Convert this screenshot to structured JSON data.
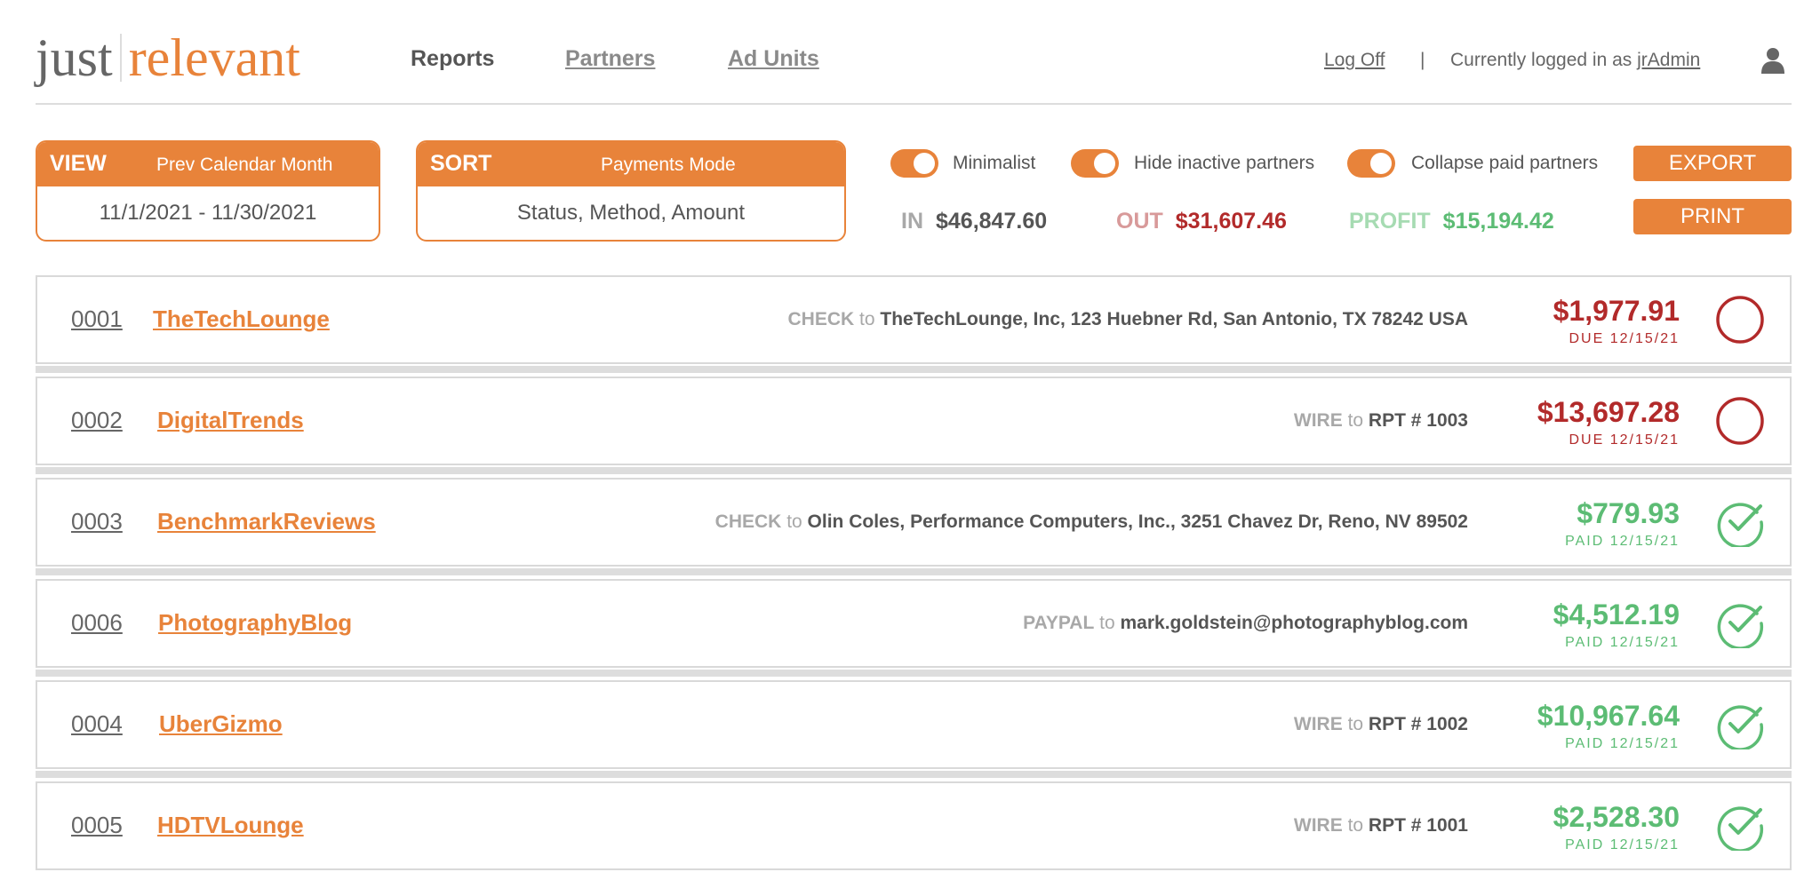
{
  "header": {
    "logo": {
      "part1": "just",
      "part2": "relevant"
    },
    "nav": [
      {
        "label": "Reports",
        "active": true
      },
      {
        "label": "Partners",
        "active": false
      },
      {
        "label": "Ad Units",
        "active": false
      }
    ],
    "logoff": "Log Off",
    "separator": "|",
    "logged_in_prefix": "Currently logged in as",
    "username": "jrAdmin",
    "user_icon": "person-icon"
  },
  "controls": {
    "view": {
      "key": "VIEW",
      "mode": "Prev Calendar Month",
      "value": "11/1/2021 - 11/30/2021"
    },
    "sort": {
      "key": "SORT",
      "mode": "Payments Mode",
      "value": "Status, Method, Amount"
    },
    "toggles": [
      {
        "label": "Minimalist",
        "on": true
      },
      {
        "label": "Hide inactive partners",
        "on": true
      },
      {
        "label": "Collapse paid partners",
        "on": true
      }
    ],
    "buttons": {
      "export": "EXPORT",
      "print": "PRINT"
    },
    "summary": {
      "in_label": "IN",
      "in_value": "$46,847.60",
      "out_label": "OUT",
      "out_value": "$31,607.46",
      "profit_label": "PROFIT",
      "profit_value": "$15,194.42"
    }
  },
  "rows": [
    {
      "id": "0001",
      "name": "TheTechLounge",
      "method": "CHECK",
      "to": "to",
      "dest": "TheTechLounge, Inc, 123 Huebner Rd, San Antonio, TX 78242 USA",
      "amount": "$1,977.91",
      "status": "DUE 12/15/21",
      "state": "due"
    },
    {
      "id": "0002",
      "name": "DigitalTrends",
      "method": "WIRE",
      "to": "to",
      "dest": "RPT # 1003",
      "amount": "$13,697.28",
      "status": "DUE 12/15/21",
      "state": "due"
    },
    {
      "id": "0003",
      "name": "BenchmarkReviews",
      "method": "CHECK",
      "to": "to",
      "dest": "Olin Coles, Performance Computers, Inc., 3251 Chavez Dr, Reno, NV 89502",
      "amount": "$779.93",
      "status": "PAID 12/15/21",
      "state": "paid"
    },
    {
      "id": "0006",
      "name": "PhotographyBlog",
      "method": "PAYPAL",
      "to": "to",
      "dest": "mark.goldstein@photographyblog.com",
      "amount": "$4,512.19",
      "status": "PAID 12/15/21",
      "state": "paid"
    },
    {
      "id": "0004",
      "name": "UberGizmo",
      "method": "WIRE",
      "to": "to",
      "dest": "RPT # 1002",
      "amount": "$10,967.64",
      "status": "PAID 12/15/21",
      "state": "paid"
    },
    {
      "id": "0005",
      "name": "HDTVLounge",
      "method": "WIRE",
      "to": "to",
      "dest": "RPT # 1001",
      "amount": "$2,528.30",
      "status": "PAID 12/15/21",
      "state": "paid"
    }
  ],
  "colors": {
    "accent": "#e8833a",
    "due": "#b22a2a",
    "paid": "#5cbc74",
    "text": "#555555"
  }
}
